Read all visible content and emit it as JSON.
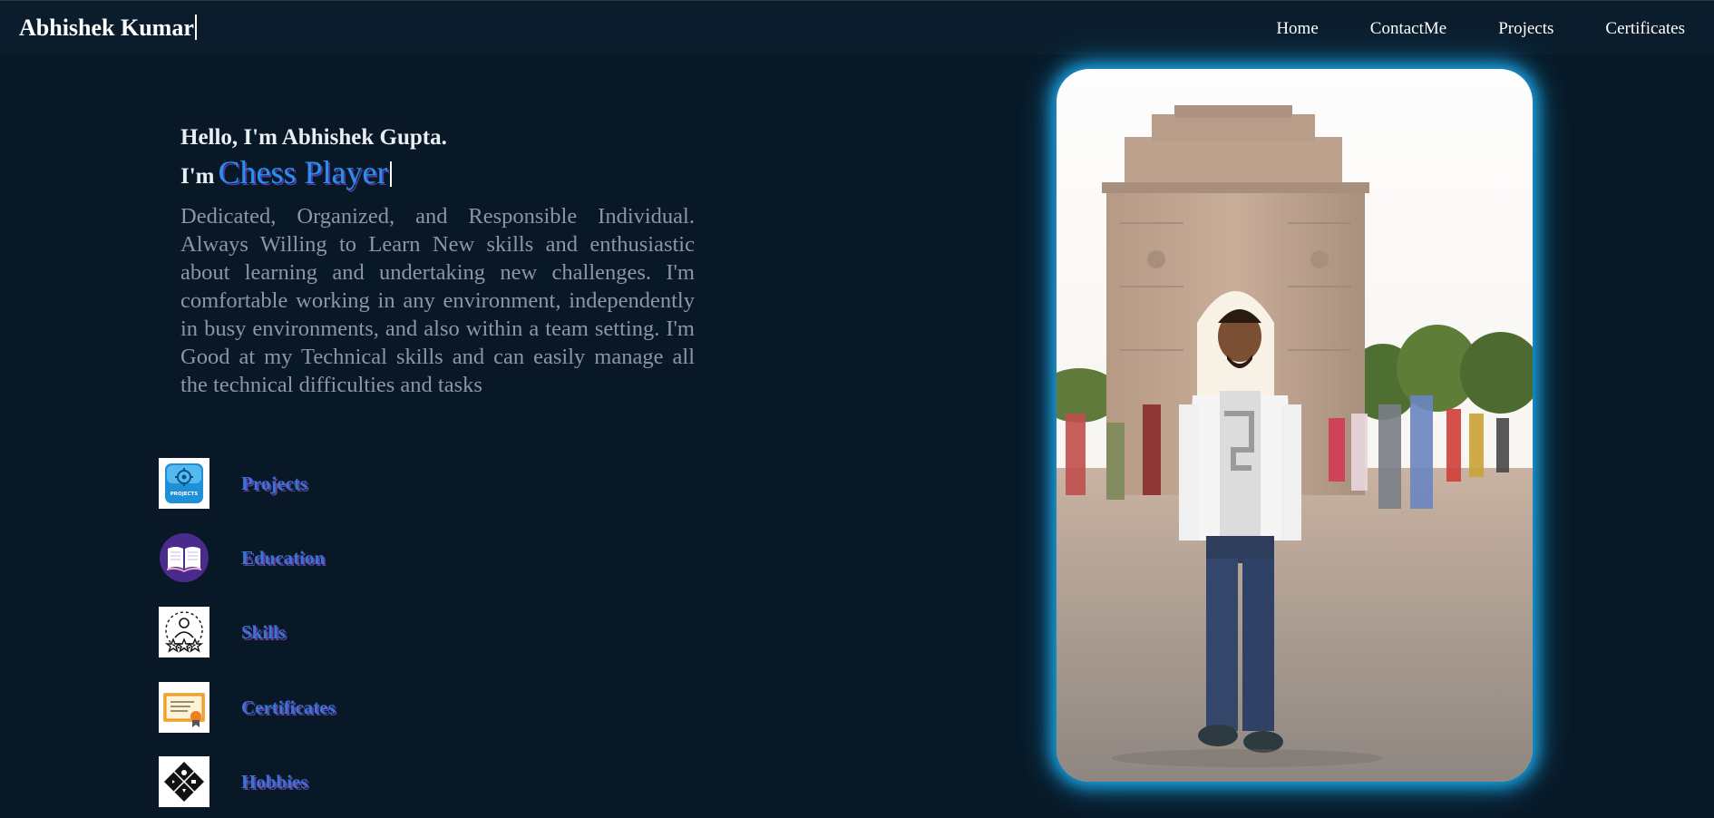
{
  "navbar": {
    "brand": "Abhishek Kumar",
    "links": [
      {
        "label": "Home"
      },
      {
        "label": "ContactMe"
      },
      {
        "label": "Projects"
      },
      {
        "label": "Certificates"
      }
    ]
  },
  "intro": {
    "greeting": "Hello, I'm Abhishek Gupta.",
    "role_prefix": "I'm",
    "role_word": "Chess Player",
    "bio": "Dedicated, Organized, and Responsible Individual. Always Willing to Learn New skills and enthusiastic about learning and undertaking new challenges. I'm comfortable working in any environment, independently in busy environments, and also within a team setting. I'm Good at my Technical skills and can easily manage all the technical difficulties and tasks"
  },
  "quick_links": [
    {
      "label": "Projects",
      "icon": "projects-icon",
      "icon_text": "PROJECTS"
    },
    {
      "label": "Education",
      "icon": "open-book-icon"
    },
    {
      "label": "Skills",
      "icon": "skills-person-stars-icon"
    },
    {
      "label": "Certificates",
      "icon": "certificate-icon"
    },
    {
      "label": "Hobbies",
      "icon": "hobbies-icon"
    }
  ],
  "colors": {
    "background": "#081826",
    "navbar": "#0b1d2c",
    "accent_blue": "#2a8ff0",
    "link_blue": "#3d72d6",
    "link_shadow": "#5b3d93",
    "photo_glow": "#1aa6e6"
  }
}
